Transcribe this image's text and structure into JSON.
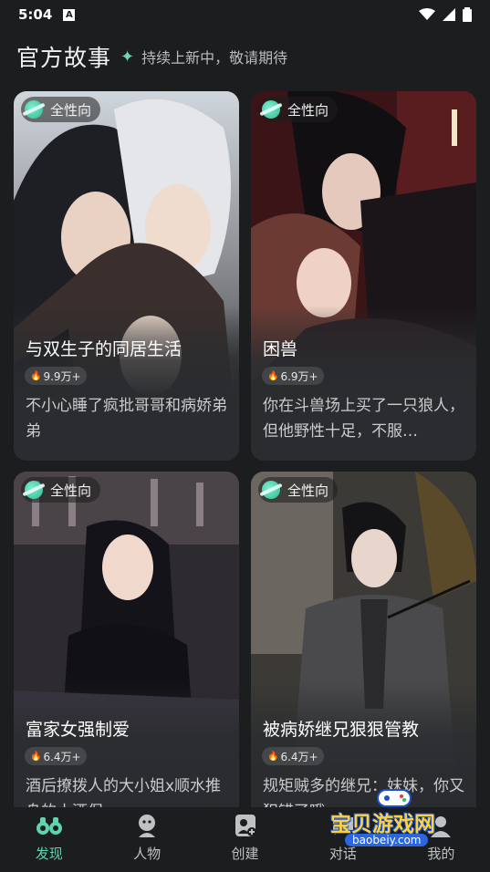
{
  "status": {
    "time": "5:04",
    "app_icon": "A"
  },
  "header": {
    "title": "官方故事",
    "subtitle": "持续上新中，敬请期待"
  },
  "cards": [
    {
      "tag": "全性向",
      "name": "与双生子的同居生活",
      "hot": "9.9万+",
      "desc": "不小心睡了疯批哥哥和病娇弟弟"
    },
    {
      "tag": "全性向",
      "name": "困兽",
      "hot": "6.9万+",
      "desc": "你在斗兽场上买了一只狼人，但他野性十足，不服…"
    },
    {
      "tag": "全性向",
      "name": "富家女强制爱",
      "hot": "6.4万+",
      "desc": "酒后撩拨人的大小姐x顺水推舟的小酒保"
    },
    {
      "tag": "全性向",
      "name": "被病娇继兄狠狠管教",
      "hot": "6.4万+",
      "desc": "规矩贼多的继兄：妹妹，你又犯错了哦～"
    }
  ],
  "tabs": [
    {
      "label": "发现",
      "icon": "binoculars-icon",
      "active": true
    },
    {
      "label": "人物",
      "icon": "character-icon",
      "active": false
    },
    {
      "label": "创建",
      "icon": "create-icon",
      "active": false
    },
    {
      "label": "对话",
      "icon": "chat-icon",
      "active": false
    },
    {
      "label": "我的",
      "icon": "profile-icon",
      "active": false
    }
  ],
  "watermark": {
    "text": "宝贝游戏网",
    "url": "baobeiy.com"
  },
  "colors": {
    "accent": "#5fd3ad",
    "background": "#1b1d1f",
    "card": "#2a2c2f"
  }
}
